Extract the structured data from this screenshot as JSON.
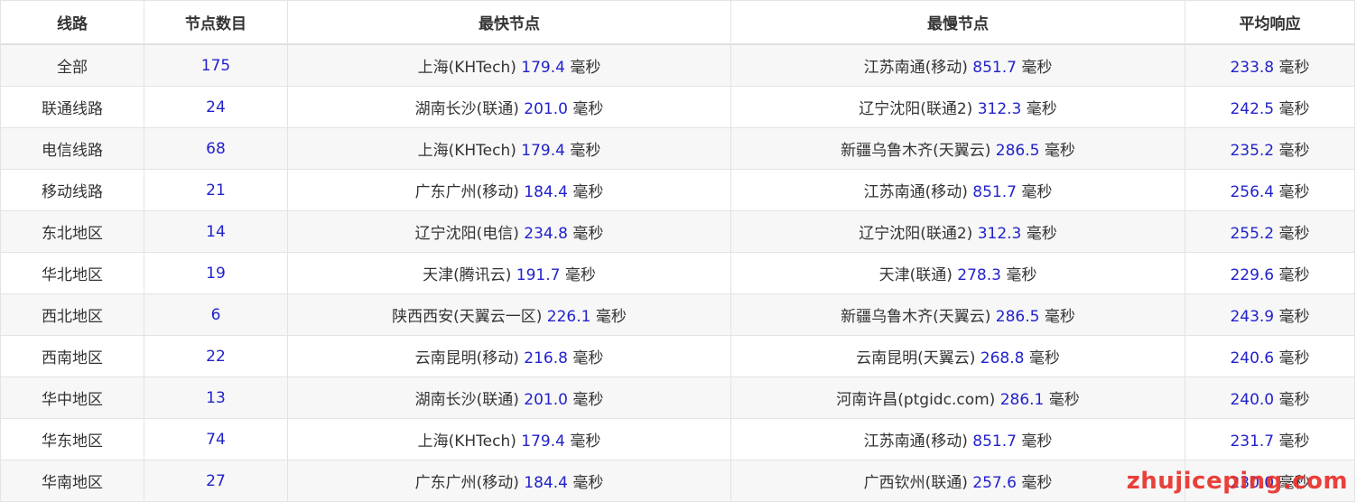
{
  "table": {
    "headers": [
      "线路",
      "节点数目",
      "最快节点",
      "最慢节点",
      "平均响应"
    ],
    "unit": "毫秒",
    "rows": [
      {
        "line": "全部",
        "count": "175",
        "fast_name": "上海(KHTech)",
        "fast_ms": "179.4",
        "slow_name": "江苏南通(移动)",
        "slow_ms": "851.7",
        "avg_ms": "233.8"
      },
      {
        "line": "联通线路",
        "count": "24",
        "fast_name": "湖南长沙(联通)",
        "fast_ms": "201.0",
        "slow_name": "辽宁沈阳(联通2)",
        "slow_ms": "312.3",
        "avg_ms": "242.5"
      },
      {
        "line": "电信线路",
        "count": "68",
        "fast_name": "上海(KHTech)",
        "fast_ms": "179.4",
        "slow_name": "新疆乌鲁木齐(天翼云)",
        "slow_ms": "286.5",
        "avg_ms": "235.2"
      },
      {
        "line": "移动线路",
        "count": "21",
        "fast_name": "广东广州(移动)",
        "fast_ms": "184.4",
        "slow_name": "江苏南通(移动)",
        "slow_ms": "851.7",
        "avg_ms": "256.4"
      },
      {
        "line": "东北地区",
        "count": "14",
        "fast_name": "辽宁沈阳(电信)",
        "fast_ms": "234.8",
        "slow_name": "辽宁沈阳(联通2)",
        "slow_ms": "312.3",
        "avg_ms": "255.2"
      },
      {
        "line": "华北地区",
        "count": "19",
        "fast_name": "天津(腾讯云)",
        "fast_ms": "191.7",
        "slow_name": "天津(联通)",
        "slow_ms": "278.3",
        "avg_ms": "229.6"
      },
      {
        "line": "西北地区",
        "count": "6",
        "fast_name": "陕西西安(天翼云一区)",
        "fast_ms": "226.1",
        "slow_name": "新疆乌鲁木齐(天翼云)",
        "slow_ms": "286.5",
        "avg_ms": "243.9"
      },
      {
        "line": "西南地区",
        "count": "22",
        "fast_name": "云南昆明(移动)",
        "fast_ms": "216.8",
        "slow_name": "云南昆明(天翼云)",
        "slow_ms": "268.8",
        "avg_ms": "240.6"
      },
      {
        "line": "华中地区",
        "count": "13",
        "fast_name": "湖南长沙(联通)",
        "fast_ms": "201.0",
        "slow_name": "河南许昌(ptgidc.com)",
        "slow_ms": "286.1",
        "avg_ms": "240.0"
      },
      {
        "line": "华东地区",
        "count": "74",
        "fast_name": "上海(KHTech)",
        "fast_ms": "179.4",
        "slow_name": "江苏南通(移动)",
        "slow_ms": "851.7",
        "avg_ms": "231.7"
      },
      {
        "line": "华南地区",
        "count": "27",
        "fast_name": "广东广州(移动)",
        "fast_ms": "184.4",
        "slow_name": "广西钦州(联通)",
        "slow_ms": "257.6",
        "avg_ms": "230.0"
      }
    ]
  },
  "watermark": "zhujiceping.com",
  "colors": {
    "value_blue": "#2222cc",
    "watermark_red": "#e8312a"
  }
}
